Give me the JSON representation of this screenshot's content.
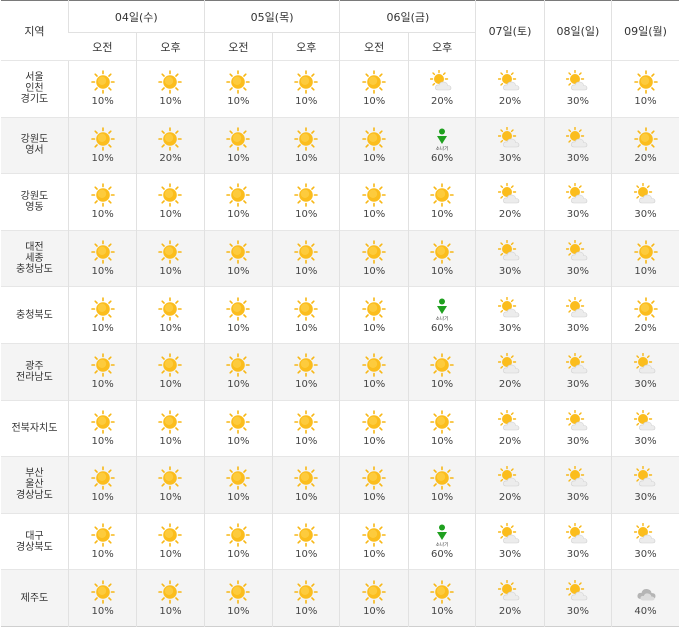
{
  "header": {
    "region_label": "지역",
    "days": [
      "04일(수)",
      "05일(목)",
      "06일(금)"
    ],
    "ampm": [
      "오전",
      "오후",
      "오전",
      "오후",
      "오전",
      "오후"
    ],
    "later_days": [
      "07일(토)",
      "08일(일)",
      "09일(월)"
    ]
  },
  "icons": {
    "sun": "sunny-icon",
    "partly": "partly-cloudy-icon",
    "cloud": "cloudy-icon",
    "shower": "shower-icon",
    "shower_label": "소나기"
  },
  "colors": {
    "sun": "#f7b716",
    "shower": "#1fa01f",
    "cloud": "#c8c8c8",
    "row_alt": "#f4f4f4"
  },
  "rows": [
    {
      "region": [
        "서울",
        "인천",
        "경기도"
      ],
      "cells": [
        {
          "icon": "sun",
          "prob": "10%"
        },
        {
          "icon": "sun",
          "prob": "10%"
        },
        {
          "icon": "sun",
          "prob": "10%"
        },
        {
          "icon": "sun",
          "prob": "10%"
        },
        {
          "icon": "sun",
          "prob": "10%"
        },
        {
          "icon": "partly",
          "prob": "20%"
        },
        {
          "icon": "partly",
          "prob": "20%"
        },
        {
          "icon": "partly",
          "prob": "30%"
        },
        {
          "icon": "sun",
          "prob": "10%"
        }
      ]
    },
    {
      "region": [
        "강원도",
        "영서"
      ],
      "cells": [
        {
          "icon": "sun",
          "prob": "10%"
        },
        {
          "icon": "sun",
          "prob": "20%"
        },
        {
          "icon": "sun",
          "prob": "10%"
        },
        {
          "icon": "sun",
          "prob": "10%"
        },
        {
          "icon": "sun",
          "prob": "10%"
        },
        {
          "icon": "shower",
          "prob": "60%"
        },
        {
          "icon": "partly",
          "prob": "30%"
        },
        {
          "icon": "partly",
          "prob": "30%"
        },
        {
          "icon": "sun",
          "prob": "20%"
        }
      ]
    },
    {
      "region": [
        "강원도",
        "영동"
      ],
      "cells": [
        {
          "icon": "sun",
          "prob": "10%"
        },
        {
          "icon": "sun",
          "prob": "10%"
        },
        {
          "icon": "sun",
          "prob": "10%"
        },
        {
          "icon": "sun",
          "prob": "10%"
        },
        {
          "icon": "sun",
          "prob": "10%"
        },
        {
          "icon": "sun",
          "prob": "10%"
        },
        {
          "icon": "partly",
          "prob": "20%"
        },
        {
          "icon": "partly",
          "prob": "30%"
        },
        {
          "icon": "partly",
          "prob": "30%"
        }
      ]
    },
    {
      "region": [
        "대전",
        "세종",
        "충청남도"
      ],
      "cells": [
        {
          "icon": "sun",
          "prob": "10%"
        },
        {
          "icon": "sun",
          "prob": "10%"
        },
        {
          "icon": "sun",
          "prob": "10%"
        },
        {
          "icon": "sun",
          "prob": "10%"
        },
        {
          "icon": "sun",
          "prob": "10%"
        },
        {
          "icon": "sun",
          "prob": "10%"
        },
        {
          "icon": "partly",
          "prob": "30%"
        },
        {
          "icon": "partly",
          "prob": "30%"
        },
        {
          "icon": "sun",
          "prob": "10%"
        }
      ]
    },
    {
      "region": [
        "충청북도"
      ],
      "cells": [
        {
          "icon": "sun",
          "prob": "10%"
        },
        {
          "icon": "sun",
          "prob": "10%"
        },
        {
          "icon": "sun",
          "prob": "10%"
        },
        {
          "icon": "sun",
          "prob": "10%"
        },
        {
          "icon": "sun",
          "prob": "10%"
        },
        {
          "icon": "shower",
          "prob": "60%"
        },
        {
          "icon": "partly",
          "prob": "30%"
        },
        {
          "icon": "partly",
          "prob": "30%"
        },
        {
          "icon": "sun",
          "prob": "20%"
        }
      ]
    },
    {
      "region": [
        "광주",
        "전라남도"
      ],
      "cells": [
        {
          "icon": "sun",
          "prob": "10%"
        },
        {
          "icon": "sun",
          "prob": "10%"
        },
        {
          "icon": "sun",
          "prob": "10%"
        },
        {
          "icon": "sun",
          "prob": "10%"
        },
        {
          "icon": "sun",
          "prob": "10%"
        },
        {
          "icon": "sun",
          "prob": "10%"
        },
        {
          "icon": "partly",
          "prob": "20%"
        },
        {
          "icon": "partly",
          "prob": "30%"
        },
        {
          "icon": "partly",
          "prob": "30%"
        }
      ]
    },
    {
      "region": [
        "전북자치도"
      ],
      "cells": [
        {
          "icon": "sun",
          "prob": "10%"
        },
        {
          "icon": "sun",
          "prob": "10%"
        },
        {
          "icon": "sun",
          "prob": "10%"
        },
        {
          "icon": "sun",
          "prob": "10%"
        },
        {
          "icon": "sun",
          "prob": "10%"
        },
        {
          "icon": "sun",
          "prob": "10%"
        },
        {
          "icon": "partly",
          "prob": "20%"
        },
        {
          "icon": "partly",
          "prob": "30%"
        },
        {
          "icon": "partly",
          "prob": "30%"
        }
      ]
    },
    {
      "region": [
        "부산",
        "울산",
        "경상남도"
      ],
      "cells": [
        {
          "icon": "sun",
          "prob": "10%"
        },
        {
          "icon": "sun",
          "prob": "10%"
        },
        {
          "icon": "sun",
          "prob": "10%"
        },
        {
          "icon": "sun",
          "prob": "10%"
        },
        {
          "icon": "sun",
          "prob": "10%"
        },
        {
          "icon": "sun",
          "prob": "10%"
        },
        {
          "icon": "partly",
          "prob": "20%"
        },
        {
          "icon": "partly",
          "prob": "30%"
        },
        {
          "icon": "partly",
          "prob": "30%"
        }
      ]
    },
    {
      "region": [
        "대구",
        "경상북도"
      ],
      "cells": [
        {
          "icon": "sun",
          "prob": "10%"
        },
        {
          "icon": "sun",
          "prob": "10%"
        },
        {
          "icon": "sun",
          "prob": "10%"
        },
        {
          "icon": "sun",
          "prob": "10%"
        },
        {
          "icon": "sun",
          "prob": "10%"
        },
        {
          "icon": "shower",
          "prob": "60%"
        },
        {
          "icon": "partly",
          "prob": "30%"
        },
        {
          "icon": "partly",
          "prob": "30%"
        },
        {
          "icon": "partly",
          "prob": "30%"
        }
      ]
    },
    {
      "region": [
        "제주도"
      ],
      "cells": [
        {
          "icon": "sun",
          "prob": "10%"
        },
        {
          "icon": "sun",
          "prob": "10%"
        },
        {
          "icon": "sun",
          "prob": "10%"
        },
        {
          "icon": "sun",
          "prob": "10%"
        },
        {
          "icon": "sun",
          "prob": "10%"
        },
        {
          "icon": "sun",
          "prob": "10%"
        },
        {
          "icon": "partly",
          "prob": "20%"
        },
        {
          "icon": "partly",
          "prob": "30%"
        },
        {
          "icon": "cloud",
          "prob": "40%"
        }
      ]
    }
  ]
}
